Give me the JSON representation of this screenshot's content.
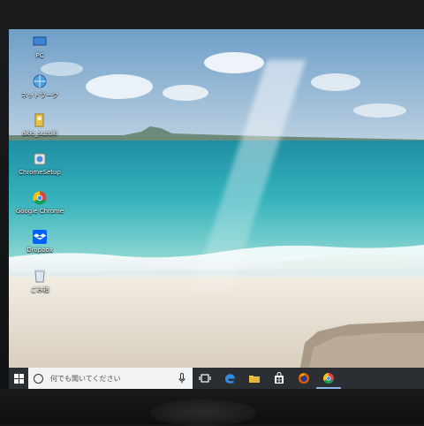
{
  "desktop_icons": [
    {
      "label": "PC",
      "icon": "computer-icon"
    },
    {
      "label": "ネットワーク",
      "icon": "network-icon"
    },
    {
      "label": "akio_suzuki",
      "icon": "user-folder-icon"
    },
    {
      "label": "ChromeSetup",
      "icon": "installer-icon"
    },
    {
      "label": "Google Chrome",
      "icon": "chrome-icon"
    },
    {
      "label": "Dropbox",
      "icon": "dropbox-icon"
    },
    {
      "label": "ごみ箱",
      "icon": "recycle-bin-icon"
    }
  ],
  "taskbar": {
    "search_placeholder": "何でも聞いてください",
    "buttons": [
      "task-view-icon",
      "edge-icon",
      "file-explorer-icon",
      "store-icon",
      "firefox-icon",
      "chrome-icon"
    ]
  },
  "colors": {
    "taskbar": "#2b2e33",
    "search_box": "#f2f3f5",
    "sky": "#8fb3d0",
    "sea": "#3fb6c0",
    "sand": "#ece4d6"
  }
}
